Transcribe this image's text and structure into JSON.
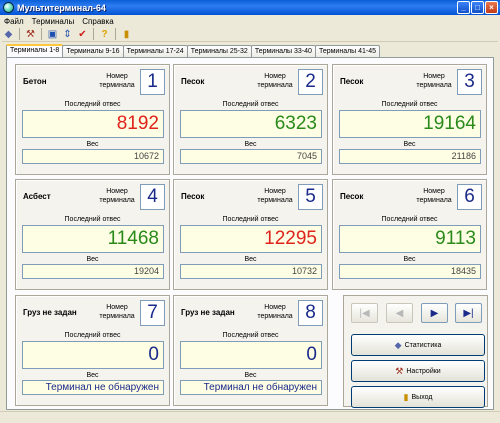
{
  "window": {
    "title": "Мультитерминал-64"
  },
  "menu": {
    "items": [
      "Файл",
      "Терминалы",
      "Справка"
    ]
  },
  "colors": {
    "red": "#e0231b",
    "green": "#2a8a1a",
    "blue": "#1a2a8a"
  },
  "tabs": [
    "Терминалы 1-8",
    "Терминалы 9-16",
    "Терминалы 17-24",
    "Терминалы 25-32",
    "Терминалы 33-40",
    "Терминалы 41-45"
  ],
  "labels": {
    "terminal_number": "Номер терминала",
    "last_weighing": "Последний отвес",
    "weight": "Вес"
  },
  "terminals": [
    {
      "material": "Бетон",
      "number": "1",
      "last": "8192",
      "last_color": "red",
      "weight": "10672"
    },
    {
      "material": "Песок",
      "number": "2",
      "last": "6323",
      "last_color": "green",
      "weight": "7045"
    },
    {
      "material": "Песок",
      "number": "3",
      "last": "19164",
      "last_color": "green",
      "weight": "21186"
    },
    {
      "material": "Асбест",
      "number": "4",
      "last": "11468",
      "last_color": "green",
      "weight": "19204"
    },
    {
      "material": "Песок",
      "number": "5",
      "last": "12295",
      "last_color": "red",
      "weight": "10732"
    },
    {
      "material": "Песок",
      "number": "6",
      "last": "9113",
      "last_color": "green",
      "weight": "18435"
    },
    {
      "material": "Груз не задан",
      "number": "7",
      "last": "0",
      "last_color": "blue",
      "weight": "Терминал не обнаружен"
    },
    {
      "material": "Груз не задан",
      "number": "8",
      "last": "0",
      "last_color": "blue",
      "weight": "Терминал не обнаружен"
    }
  ],
  "actions": {
    "statistics": "Статистика",
    "settings": "Настройки",
    "exit": "Выход"
  }
}
